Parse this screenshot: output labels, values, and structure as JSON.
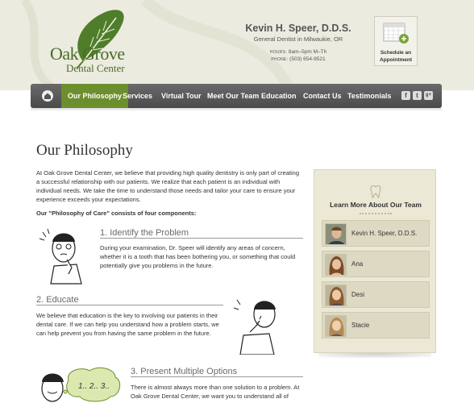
{
  "logo": {
    "main": "Oak Grove",
    "sub": "Dental Center"
  },
  "doctor": {
    "name": "Kevin H. Speer, D.D.S.",
    "title": "General Dentist in Milwaukie, OR",
    "hours_label": "HOURS:",
    "hours": "8am–5pm M–Th",
    "phone_label": "PHONE:",
    "phone": "(503) 654-9521"
  },
  "appointment": {
    "line1": "Schedule an",
    "line2": "Appointment"
  },
  "nav": {
    "items": [
      "Our Philosophy",
      "Services",
      "Virtual Tour",
      "Meet Our Team",
      "Education",
      "Contact Us",
      "Testimonials"
    ],
    "active": "Our Philosophy",
    "social": [
      "f",
      "t",
      "g+"
    ]
  },
  "main": {
    "title": "Our Philosophy",
    "intro": "At Oak Grove Dental Center, we believe that providing high quality dentistry is only part of creating a successful relationship with our patients. We realize that each patient is an individual with individual needs. We take the time to understand those needs and tailor your care to ensure your experience exceeds your expectations.",
    "components_heading": "Our \"Philosophy of Care\" consists of four components:",
    "sections": [
      {
        "title": "1. Identify the Problem",
        "text": "During your examination, Dr. Speer will identify any areas of concern, whether it is a tooth that has been bothering you, or something that could potentially give you problems in the future."
      },
      {
        "title": "2. Educate",
        "text": "We believe that education is the key to involving our patients in their dental care. If we can help you understand how a problem starts, we can help prevent you from having the same problem in the future."
      },
      {
        "title": "3. Present Multiple Options",
        "text": "There is almost always more than one solution to a problem. At Oak Grove Dental Center, we want you to understand all of"
      }
    ],
    "bubble_text": "1.. 2.. 3.."
  },
  "sidebar": {
    "title": "Learn More About Our Team",
    "members": [
      "Kevin H. Speer, D.D.S.",
      "Ana",
      "Desi",
      "Stacie"
    ]
  },
  "colors": {
    "accent_green": "#6b8f2d",
    "header_bg": "#ecebdf",
    "nav_bg": "#555555",
    "sidebar_bg": "#ebe8d5"
  },
  "icons": [
    "home-icon",
    "facebook-icon",
    "twitter-icon",
    "google-plus-icon",
    "calendar-icon",
    "tooth-icon",
    "leaf-icon"
  ]
}
